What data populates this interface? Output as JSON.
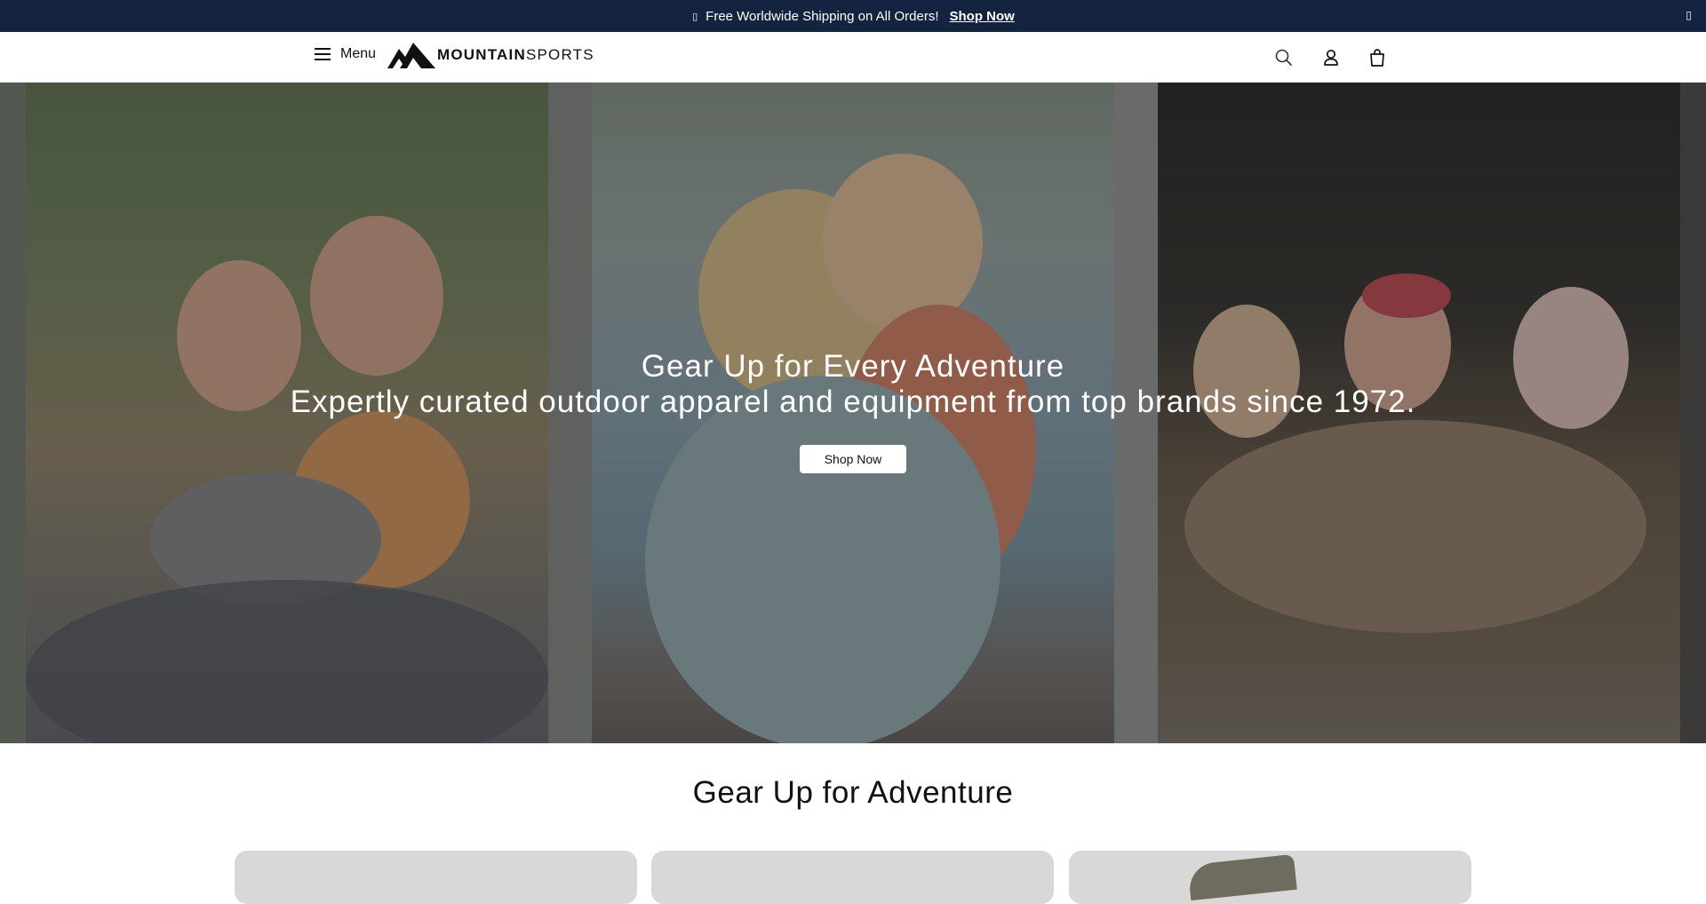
{
  "announcement": {
    "message": "Free Worldwide Shipping on All Orders!",
    "link": "Shop Now",
    "icon": "missing-glyph-icon",
    "close_icon": "close-icon"
  },
  "header": {
    "menu_label": "Menu",
    "logo_bold": "MOUNTAIN",
    "logo_light": "SPORTS",
    "icons": [
      "search-icon",
      "account-icon",
      "cart-icon"
    ]
  },
  "hero": {
    "title": "Gear Up for Every Adventure",
    "subtitle": "Expertly curated outdoor apparel and equipment from top brands since 1972.",
    "button": "Shop Now"
  },
  "section": {
    "title": "Gear Up for Adventure"
  },
  "colors": {
    "announcement_bg": "#14233f",
    "header_bg": "#ffffff",
    "button_bg": "#ffffff"
  }
}
